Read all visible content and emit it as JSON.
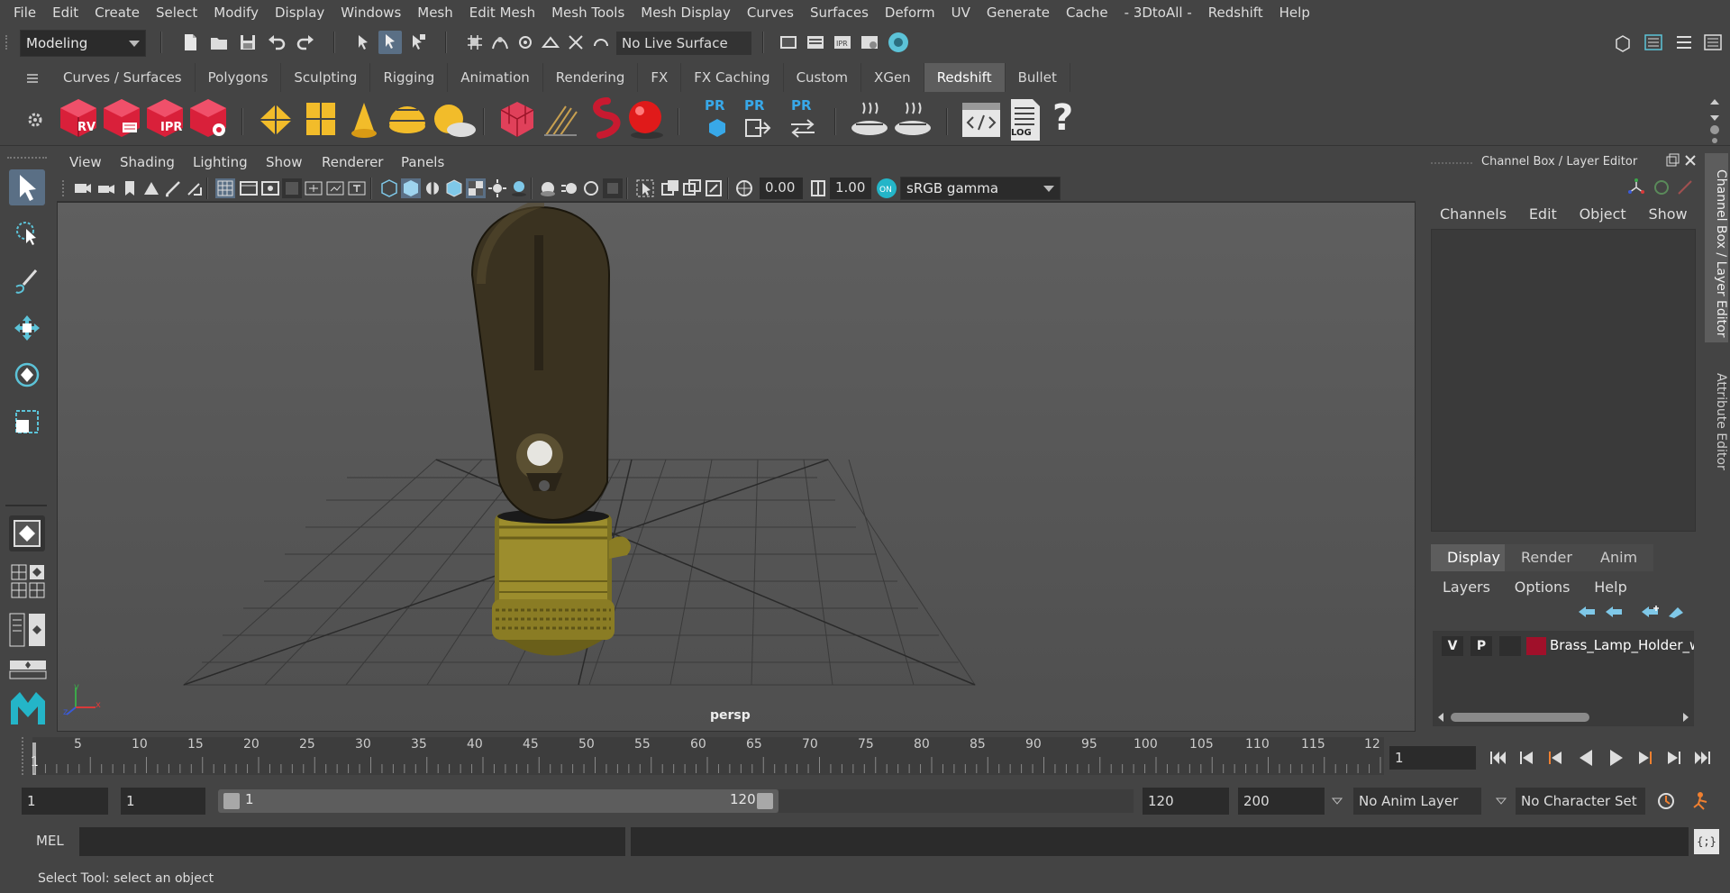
{
  "menubar": {
    "items": [
      "File",
      "Edit",
      "Create",
      "Select",
      "Modify",
      "Display",
      "Windows",
      "Mesh",
      "Edit Mesh",
      "Mesh Tools",
      "Mesh Display",
      "Curves",
      "Surfaces",
      "Deform",
      "UV",
      "Generate",
      "Cache",
      "- 3DtoAll -",
      "Redshift",
      "Help"
    ]
  },
  "statusline": {
    "menuset": "Modeling",
    "live_surface": "No Live Surface"
  },
  "shelf": {
    "tabs": [
      "Curves / Surfaces",
      "Polygons",
      "Sculpting",
      "Rigging",
      "Animation",
      "Rendering",
      "FX",
      "FX Caching",
      "Custom",
      "XGen",
      "Redshift",
      "Bullet"
    ],
    "active_tab": "Redshift",
    "pr_label": "PR",
    "rv_label": "RV",
    "ipr_label": "IPR",
    "log_label": "LOG",
    "help_label": "?"
  },
  "viewport": {
    "menus": [
      "View",
      "Shading",
      "Lighting",
      "Show",
      "Renderer",
      "Panels"
    ],
    "exposure": "0.00",
    "gamma": "1.00",
    "color_space": "sRGB gamma",
    "camera": "persp",
    "axis_y": "y",
    "axis_x": "x",
    "axis_z": "z"
  },
  "channel_box": {
    "title": "Channel Box / Layer Editor",
    "menus": [
      "Channels",
      "Edit",
      "Object",
      "Show"
    ],
    "layer_tabs": [
      "Display",
      "Render",
      "Anim"
    ],
    "layer_menus": [
      "Layers",
      "Options",
      "Help"
    ],
    "layer": {
      "visible": "V",
      "playback": "P",
      "name": "Brass_Lamp_Holder_wi",
      "color": "#a0102a"
    }
  },
  "side_tabs": [
    "Channel Box / Layer Editor",
    "Attribute Editor"
  ],
  "timeline": {
    "ticks": [
      "5",
      "10",
      "15",
      "20",
      "25",
      "30",
      "35",
      "40",
      "45",
      "50",
      "55",
      "60",
      "65",
      "70",
      "75",
      "80",
      "85",
      "90",
      "95",
      "100",
      "105",
      "110",
      "115",
      "12"
    ],
    "current_frame_marker": "1",
    "current_frame": "1"
  },
  "range": {
    "start": "1",
    "playback_start": "1",
    "slider_start": "1",
    "slider_end": "120",
    "playback_end": "120",
    "end": "200",
    "anim_layer": "No Anim Layer",
    "char_set": "No Character Set"
  },
  "command": {
    "label": "MEL",
    "script_btn": "{;}"
  },
  "help_line": "Select Tool: select an object",
  "colors": {
    "accent": "#5a6f85",
    "layer_red": "#a0102a",
    "redshift_red": "#d9203a",
    "gold": "#f2bc2a"
  }
}
